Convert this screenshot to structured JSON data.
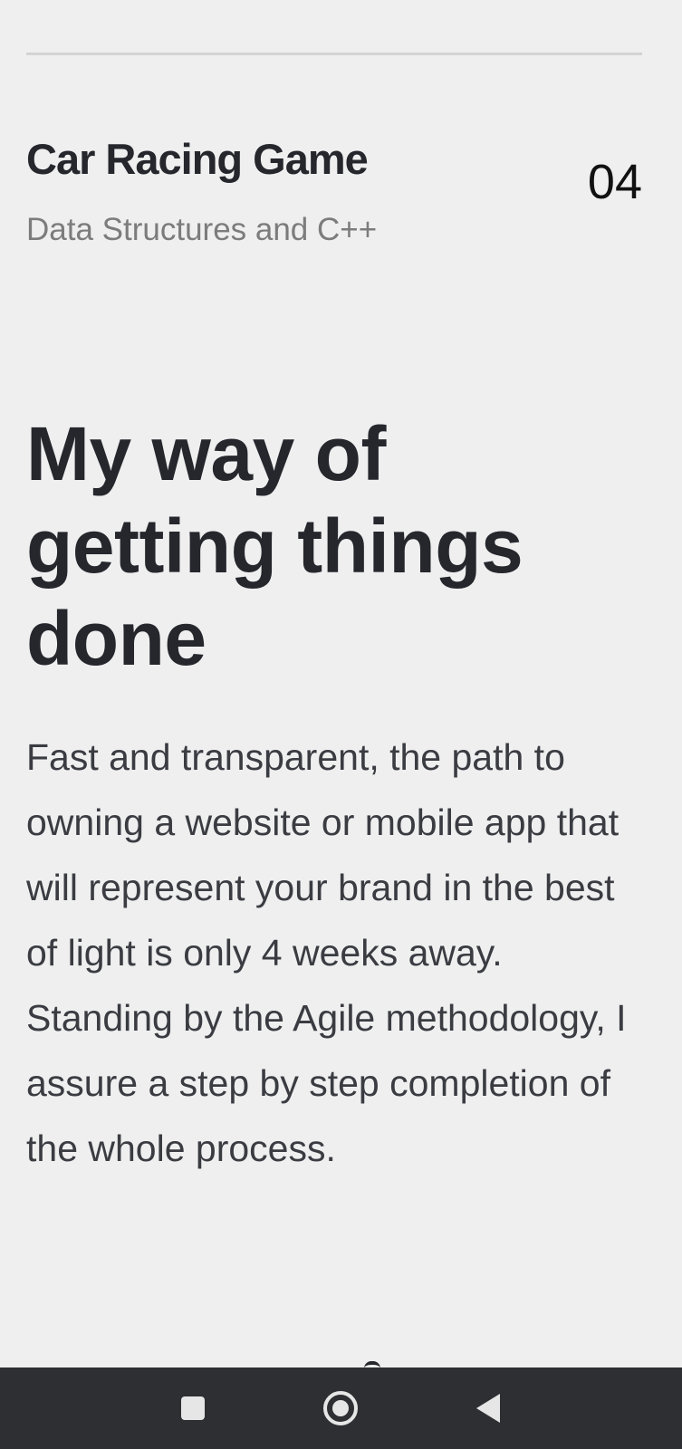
{
  "project": {
    "title": "Car Racing Game",
    "subtitle": "Data Structures and C++",
    "number": "04"
  },
  "process": {
    "headline": "My way of getting things done",
    "description": "Fast and transparent, the path to owning a website or mobile app that will represent your brand in the best of light is only 4 weeks away. Standing by the Agile methodology, I assure a step by step completion of the whole process."
  },
  "navbar": {
    "recent_icon": "square-icon",
    "home_icon": "circle-icon",
    "back_icon": "triangle-back-icon"
  }
}
